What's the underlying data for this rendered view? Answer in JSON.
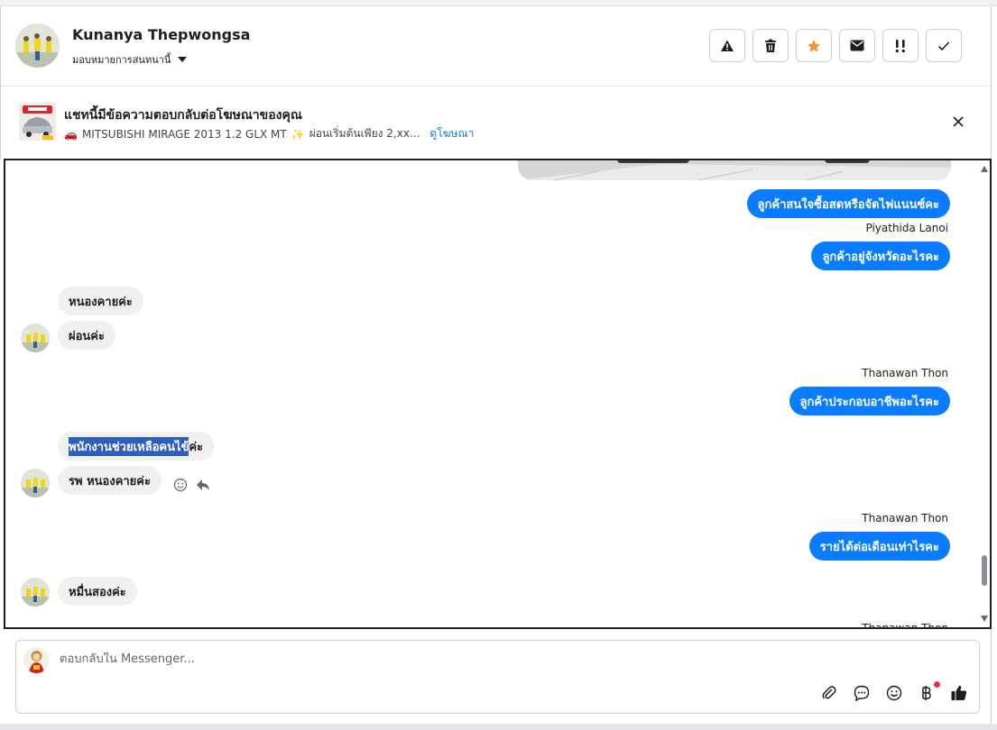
{
  "header": {
    "contact_name": "Kunanya Thepwongsa",
    "assign_label": "มอบหมายการสนทนานี้",
    "actions": [
      {
        "name": "spam-icon"
      },
      {
        "name": "trash-icon"
      },
      {
        "name": "star-icon"
      },
      {
        "name": "mail-icon"
      },
      {
        "name": "follow-up-icon"
      },
      {
        "name": "done-icon"
      }
    ]
  },
  "ad": {
    "title": "แชทนี้มีข้อความตอบกลับต่อโฆษณาของคุณ",
    "car_emoji": "🚗",
    "subtitle": "MITSUBISHI MIRAGE 2013 1.2 GLX MT",
    "sparkle": "✨",
    "subtitle_rest": "ผ่อนเริ่มต้นเพียง 2,xx...",
    "link": "ดูโฆษณา"
  },
  "messages": {
    "m1": "ลูกค้าสนใจซื้อสดหรือจัดไฟแนนซ์คะ",
    "sender1": "Piyathida Lanoi",
    "m2": "ลูกค้าอยู่จังหวัดอะไรคะ",
    "m3": "หนองคายค่ะ",
    "m4": "ผ่อนค่ะ",
    "sender2": "Thanawan Thon",
    "m5": "ลูกค้าประกอบอาชีพอะไรคะ",
    "m6_selected": "พนักงานช่วยเหลือคนไข้",
    "m6_rest": "ค่ะ",
    "m7": "รพ หนองคายค่ะ",
    "sender3": "Thanawan Thon",
    "m8": "รายได้ต่อเดือนเท่าไรคะ",
    "m9": "หมื่นสองค่ะ",
    "sender4_partial": "Thanawan Thon"
  },
  "composer": {
    "placeholder": "ตอบกลับใน Messenger..."
  },
  "colors": {
    "outgoing_bubble": "#0a7cff",
    "incoming_bubble": "#f0f0f0",
    "star": "#f7923b",
    "link": "#1877f2",
    "highlight": "#2f5fbd"
  }
}
